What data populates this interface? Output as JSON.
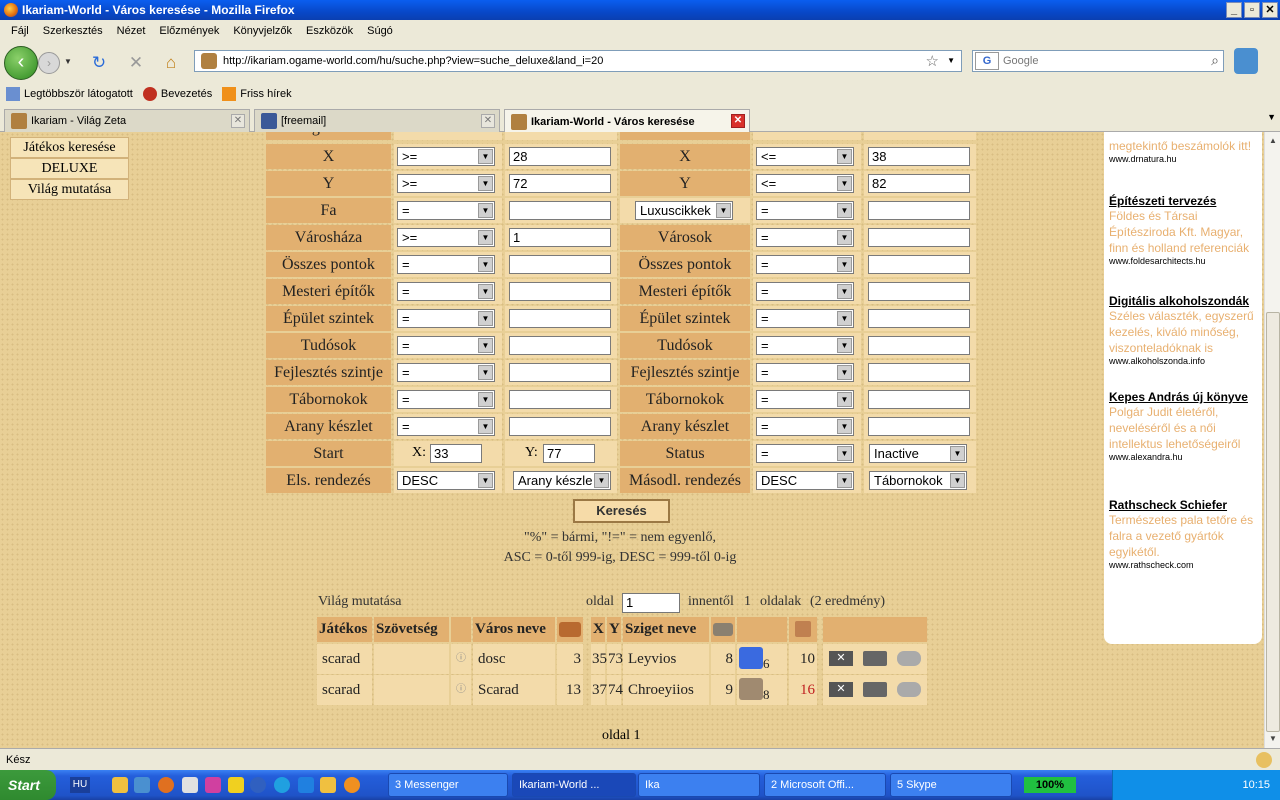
{
  "window": {
    "title": "Ikariam-World - Város keresése - Mozilla Firefox"
  },
  "menu": [
    "Fájl",
    "Szerkesztés",
    "Nézet",
    "Előzmények",
    "Könyvjelzők",
    "Eszközök",
    "Súgó"
  ],
  "navigation": {
    "url": "http://ikariam.ogame-world.com/hu/suche.php?view=suche_deluxe&land_i=20",
    "search_placeholder": "Google"
  },
  "bookmarks": [
    "Legtöbbször látogatott",
    "Bevezetés",
    "Friss hírek"
  ],
  "tabs": [
    {
      "label": "Ikariam - Világ Zeta",
      "active": false
    },
    {
      "label": "[freemail]",
      "active": false
    },
    {
      "label": "Ikariam-World - Város keresése",
      "active": true
    }
  ],
  "left_menu": [
    "Játékos keresése",
    "DELUXE",
    "Világ mutatása"
  ],
  "form": {
    "top_partial_left": "Sziget neve",
    "top_partial_right": "Város neve",
    "rows": [
      {
        "l_label": "X",
        "l_op": ">=",
        "l_val": "28",
        "r_label": "X",
        "r_op": "<=",
        "r_val": "38"
      },
      {
        "l_label": "Y",
        "l_op": ">=",
        "l_val": "72",
        "r_label": "Y",
        "r_op": "<=",
        "r_val": "82"
      },
      {
        "l_label": "Fa",
        "l_op": "=",
        "l_val": "",
        "r_label": "Luxuscikkek",
        "r_op": "=",
        "r_val": ""
      },
      {
        "l_label": "Városháza",
        "l_op": ">=",
        "l_val": "1",
        "r_label": "Városok",
        "r_op": "=",
        "r_val": ""
      },
      {
        "l_label": "Összes pontok",
        "l_op": "=",
        "l_val": "",
        "r_label": "Összes pontok",
        "r_op": "=",
        "r_val": ""
      },
      {
        "l_label": "Mesteri építők",
        "l_op": "=",
        "l_val": "",
        "r_label": "Mesteri építők",
        "r_op": "=",
        "r_val": ""
      },
      {
        "l_label": "Épület szintek",
        "l_op": "=",
        "l_val": "",
        "r_label": "Épület szintek",
        "r_op": "=",
        "r_val": ""
      },
      {
        "l_label": "Tudósok",
        "l_op": "=",
        "l_val": "",
        "r_label": "Tudósok",
        "r_op": "=",
        "r_val": ""
      },
      {
        "l_label": "Fejlesztés szintje",
        "l_op": "=",
        "l_val": "",
        "r_label": "Fejlesztés szintje",
        "r_op": "=",
        "r_val": ""
      },
      {
        "l_label": "Tábornokok",
        "l_op": "=",
        "l_val": "",
        "r_label": "Tábornokok",
        "r_op": "=",
        "r_val": ""
      },
      {
        "l_label": "Arany készlet",
        "l_op": "=",
        "l_val": "",
        "r_label": "Arany készlet",
        "r_op": "=",
        "r_val": ""
      }
    ],
    "start": {
      "label": "Start",
      "x_label": "X:",
      "x_val": "33",
      "y_label": "Y:",
      "y_val": "77"
    },
    "status": {
      "label": "Status",
      "op": "=",
      "val": "Inactive"
    },
    "sort1": {
      "label": "Els. rendezés",
      "order": "DESC",
      "field": "Arany készle"
    },
    "sort2": {
      "label": "Másodl. rendezés",
      "order": "DESC",
      "field": "Tábornokok"
    },
    "search_button": "Keresés",
    "note1": "\"%\" = bármi, \"!=\" = nem egyenlő,",
    "note2": "ASC = 0-től 999-ig, DESC = 999-től 0-ig"
  },
  "results": {
    "world_link": "Világ mutatása",
    "page_label": "oldal",
    "page_val": "1",
    "of_label": "innentől",
    "of_val": "1",
    "pages_label": "oldalak",
    "count": "(2 eredmény)",
    "headers": [
      "Játékos",
      "Szövetség",
      "Város neve",
      "X",
      "Y",
      "Sziget neve"
    ],
    "rows": [
      {
        "player": "scarad",
        "alliance": "",
        "city": "dosc",
        "citylvl": "3",
        "x": "35",
        "y": "73",
        "island": "Leyvios",
        "islvl": "8",
        "res": "6",
        "wonder": "10",
        "wonder_color": "#222"
      },
      {
        "player": "scarad",
        "alliance": "",
        "city": "Scarad",
        "citylvl": "13",
        "x": "37",
        "y": "74",
        "island": "Chroeyiios",
        "islvl": "9",
        "res": "8",
        "wonder": "16",
        "wonder_color": "#c02020"
      }
    ],
    "footer": "oldal 1"
  },
  "ads": [
    {
      "title": "",
      "desc": "megtekintő beszámolók itt!",
      "url": "www.drnatura.hu"
    },
    {
      "title": "Építészeti tervezés",
      "desc": "Földes és Társai Építésziroda Kft. Magyar, finn és holland referenciák",
      "url": "www.foldesarchitects.hu"
    },
    {
      "title": "Digitális alkoholszondák",
      "desc": "Széles választék, egyszerű kezelés, kiváló minőség, viszonteladóknak is",
      "url": "www.alkoholszonda.info"
    },
    {
      "title": "Kepes András új könyve",
      "desc": "Polgár Judit életéről, neveléséről és a női intellektus lehetőségeiről",
      "url": "www.alexandra.hu"
    },
    {
      "title": "Rathscheck Schiefer",
      "desc": "Természetes pala tetőre és falra a vezető gyártók egyikétől.",
      "url": "www.rathscheck.com"
    }
  ],
  "status_bar": "Kész",
  "taskbar": {
    "start": "Start",
    "lang": "HU",
    "tasks": [
      "3 Messenger",
      "Ikariam-World ...",
      "Ika",
      "2 Microsoft Offi...",
      "5 Skype"
    ],
    "battery": "100%",
    "clock": "10:15"
  }
}
